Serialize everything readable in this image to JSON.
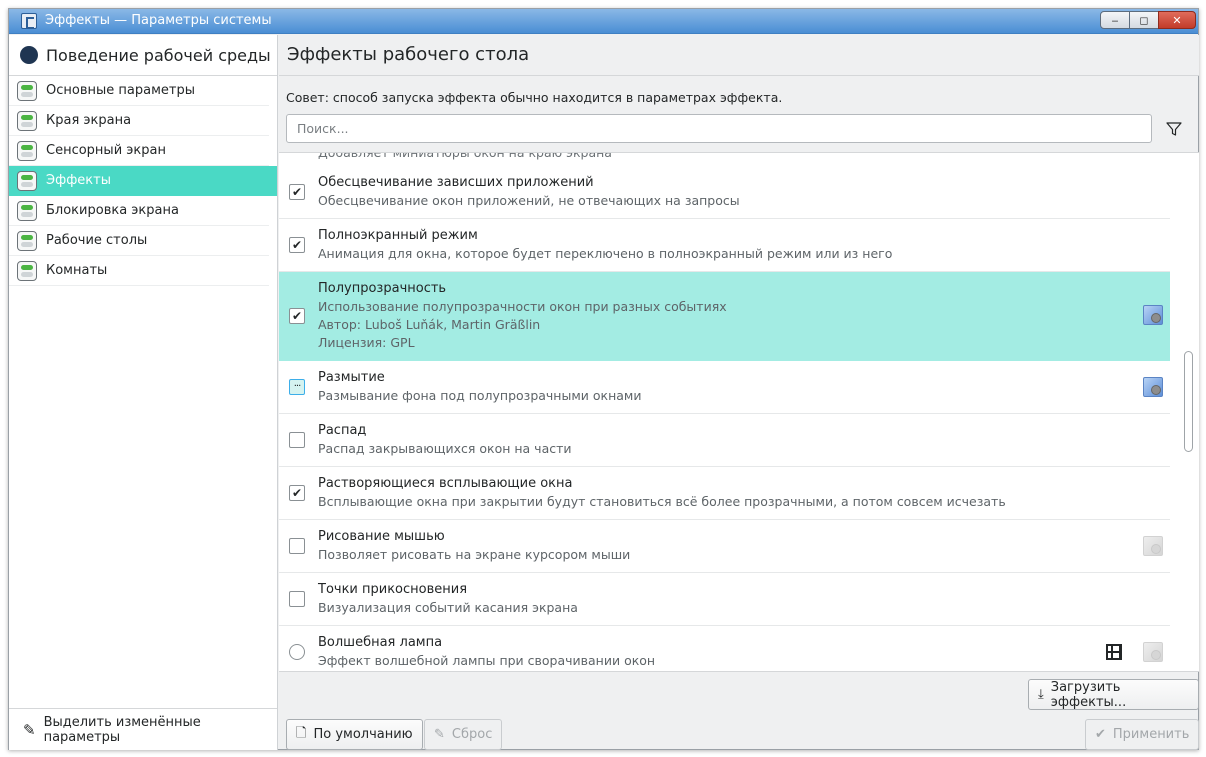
{
  "window": {
    "title": "Эффекты — Параметры системы",
    "controls": [
      "‒",
      "◻",
      "✕"
    ]
  },
  "sidebar": {
    "header": "Поведение рабочей среды",
    "items": [
      {
        "label": "Основные параметры"
      },
      {
        "label": "Края экрана"
      },
      {
        "label": "Сенсорный экран"
      },
      {
        "label": "Эффекты",
        "active": true
      },
      {
        "label": "Блокировка экрана"
      },
      {
        "label": "Рабочие столы"
      },
      {
        "label": "Комнаты"
      }
    ],
    "footer": "Выделить изменённые параметры"
  },
  "main": {
    "title": "Эффекты рабочего стола",
    "hint": "Совет: способ запуска эффекта обычно находится в параметрах эффекта.",
    "search_placeholder": "Поиск...",
    "clipped_text": "Добавляет миниатюры окон на краю экрана",
    "effects": [
      {
        "name": "Обесцвечивание зависших приложений",
        "desc": "Обесцвечивание окон приложений, не отвечающих на запросы",
        "state": "checked"
      },
      {
        "name": "Полноэкранный режим",
        "desc": "Анимация для окна, которое будет переключено в полноэкранный режим или из него",
        "state": "checked"
      },
      {
        "name": "Полупрозрачность",
        "desc": "Использование полупрозрачности окон при разных событиях",
        "author": "Автор: Luboš Luňák, Martin Gräßlin",
        "license": "Лицензия: GPL",
        "state": "checked",
        "selected": true,
        "configurable": true
      },
      {
        "name": "Размытие",
        "desc": "Размывание фона под полупрозрачными окнами",
        "state": "partial",
        "configurable": true
      },
      {
        "name": "Распад",
        "desc": "Распад закрывающихся окон на части",
        "state": "unchecked"
      },
      {
        "name": "Растворяющиеся всплывающие окна",
        "desc": "Всплывающие окна при закрытии будут становиться всё более прозрачными, а потом совсем исчезать",
        "state": "checked"
      },
      {
        "name": "Рисование мышью",
        "desc": "Позволяет рисовать на экране курсором мыши",
        "state": "unchecked",
        "configurable_dim": true
      },
      {
        "name": "Точки прикосновения",
        "desc": "Визуализация событий касания экрана",
        "state": "unchecked"
      },
      {
        "name": "Волшебная лампа",
        "desc": "Эффект волшебной лампы при сворачивании окон",
        "state": "radio",
        "video": true,
        "configurable_dim": true
      }
    ],
    "buttons": {
      "download": "Загрузить эффекты...",
      "defaults": "По умолчанию",
      "reset": "Сброс",
      "apply": "Применить"
    }
  },
  "colors": {
    "accent": "#4ad9c5",
    "selection": "#a3ece3",
    "titlebar": "#4a8ed4"
  }
}
